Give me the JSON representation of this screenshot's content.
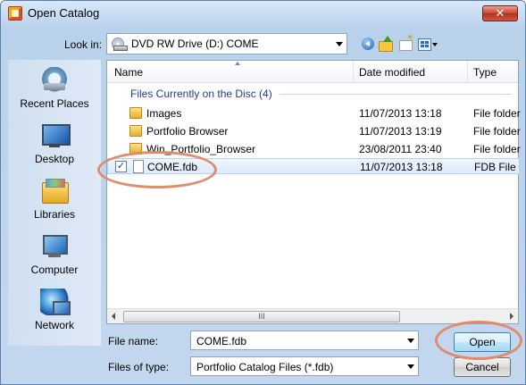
{
  "window": {
    "title": "Open Catalog",
    "close_label": "✕"
  },
  "toolbar": {
    "look_in_label": "Look in:",
    "look_in_value": "DVD RW Drive (D:) COME"
  },
  "places": [
    {
      "label": "Recent Places"
    },
    {
      "label": "Desktop"
    },
    {
      "label": "Libraries"
    },
    {
      "label": "Computer"
    },
    {
      "label": "Network"
    }
  ],
  "filelist": {
    "columns": {
      "name": "Name",
      "date": "Date modified",
      "type": "Type"
    },
    "group": "Files Currently on the Disc (4)",
    "rows": [
      {
        "name": "Images",
        "date": "11/07/2013 13:18",
        "type": "File folder",
        "kind": "folder"
      },
      {
        "name": "Portfolio Browser",
        "date": "11/07/2013 13:19",
        "type": "File folder",
        "kind": "folder"
      },
      {
        "name": "Win_Portfolio_Browser",
        "date": "23/08/2011 23:40",
        "type": "File folder",
        "kind": "folder"
      },
      {
        "name": "COME.fdb",
        "date": "11/07/2013 13:18",
        "type": "FDB File",
        "kind": "file",
        "checked": "✓",
        "selected": true
      }
    ],
    "scroll_grip": "III"
  },
  "footer": {
    "filename_label": "File name:",
    "filename_value": "COME.fdb",
    "filetype_label": "Files of type:",
    "filetype_value": "Portfolio Catalog Files (*.fdb)",
    "open_label": "Open",
    "cancel_label": "Cancel"
  },
  "colors": {
    "highlight": "#e08c6c",
    "selection": "#dcebfb",
    "group_text": "#1e3f8a"
  }
}
